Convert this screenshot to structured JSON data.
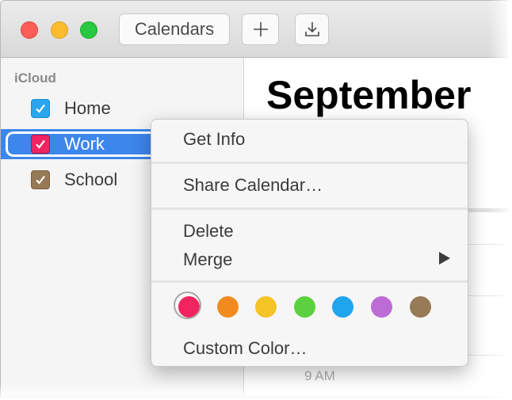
{
  "toolbar": {
    "calendars_label": "Calendars",
    "add_icon": "+",
    "import_icon": "download-icon"
  },
  "sidebar": {
    "section": "iCloud",
    "items": [
      {
        "label": "Home",
        "checked": true,
        "color": "#2aa5ee"
      },
      {
        "label": "Work",
        "checked": true,
        "color": "#f0245e",
        "selected": true
      },
      {
        "label": "School",
        "checked": true,
        "color": "#977955"
      }
    ]
  },
  "main": {
    "month_title": "September",
    "hour_label": "9 AM"
  },
  "context_menu": {
    "items": {
      "get_info": "Get Info",
      "share": "Share Calendar…",
      "delete": "Delete",
      "merge": "Merge",
      "custom_color": "Custom Color…"
    },
    "colors": [
      {
        "name": "red",
        "hex": "#f2245f",
        "selected": true
      },
      {
        "name": "orange",
        "hex": "#f28b1f"
      },
      {
        "name": "yellow",
        "hex": "#f4c324"
      },
      {
        "name": "green",
        "hex": "#5cd13f"
      },
      {
        "name": "blue",
        "hex": "#1fa5ee"
      },
      {
        "name": "purple",
        "hex": "#be6cd5"
      },
      {
        "name": "brown",
        "hex": "#977a58"
      }
    ]
  }
}
